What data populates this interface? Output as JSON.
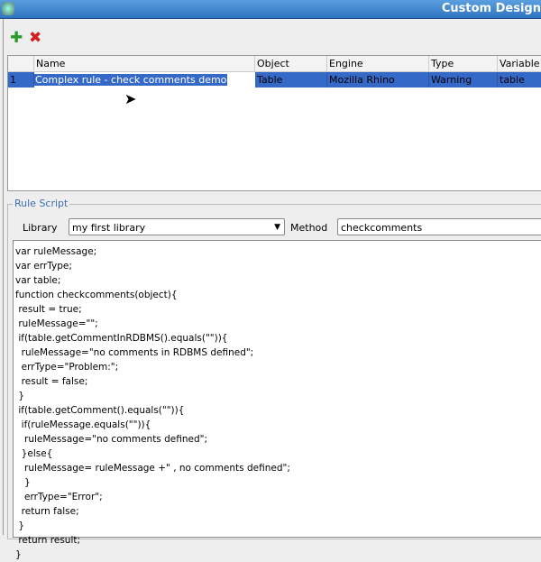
{
  "window": {
    "title": "Custom Design"
  },
  "toolbar": {
    "add_icon": "plus-icon",
    "delete_icon": "x-icon"
  },
  "table": {
    "columns": [
      "",
      "Name",
      "Object",
      "Engine",
      "Type",
      "Variable"
    ],
    "rows": [
      {
        "num": "1",
        "name": "Complex rule - check comments demo",
        "object": "Table",
        "engine": "Mozilla Rhino",
        "type": "Warning",
        "variable": "table"
      }
    ]
  },
  "rule_script": {
    "legend": "Rule Script",
    "library_label": "Library",
    "library_value": "my first library",
    "method_label": "Method",
    "method_value": "checkcomments",
    "code": "var ruleMessage;\nvar errType;\nvar table;\nfunction checkcomments(object){\n result = true;\n ruleMessage=\"\";\n if(table.getCommentInRDBMS().equals(\"\")){\n  ruleMessage=\"no comments in RDBMS defined\";\n  errType=\"Problem:\";\n  result = false;\n }\n if(table.getComment().equals(\"\")){\n  if(ruleMessage.equals(\"\")){\n   ruleMessage=\"no comments defined\";\n  }else{\n   ruleMessage= ruleMessage +\" , no comments defined\";\n   }\n   errType=\"Error\";\n  return false;\n }\n return result;\n}"
  },
  "colors": {
    "selection": "#3569c8",
    "title_bar": "#3a80c8"
  }
}
